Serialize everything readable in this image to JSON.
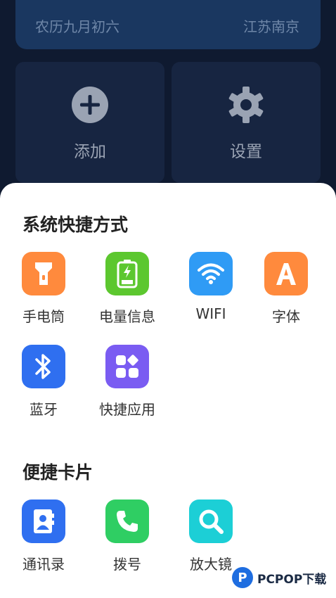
{
  "date_card": {
    "lunar": "农历九月初六",
    "city": "江苏南京"
  },
  "tiles": [
    {
      "label": "添加",
      "icon": "plus-circle-icon"
    },
    {
      "label": "设置",
      "icon": "gear-icon"
    }
  ],
  "sections": [
    {
      "title": "系统快捷方式",
      "items": [
        {
          "label": "手电筒",
          "icon": "flashlight-icon",
          "color": "#ff8a3d"
        },
        {
          "label": "电量信息",
          "icon": "battery-icon",
          "color": "#5cc72f"
        },
        {
          "label": "WIFI",
          "icon": "wifi-icon",
          "color": "#2f9bf5"
        },
        {
          "label": "字体",
          "icon": "font-icon",
          "color": "#ff8a3d"
        },
        {
          "label": "蓝牙",
          "icon": "bluetooth-icon",
          "color": "#2f6ff0"
        },
        {
          "label": "快捷应用",
          "icon": "apps-icon",
          "color": "#7a5cf2"
        }
      ]
    },
    {
      "title": "便捷卡片",
      "items": [
        {
          "label": "通讯录",
          "icon": "contacts-icon",
          "color": "#2f6ff0"
        },
        {
          "label": "拨号",
          "icon": "phone-icon",
          "color": "#2fce63"
        },
        {
          "label": "放大镜",
          "icon": "magnifier-icon",
          "color": "#1ccfd6"
        }
      ]
    }
  ],
  "watermark": {
    "text": "PCPOP下载",
    "logo_letter": "P"
  }
}
